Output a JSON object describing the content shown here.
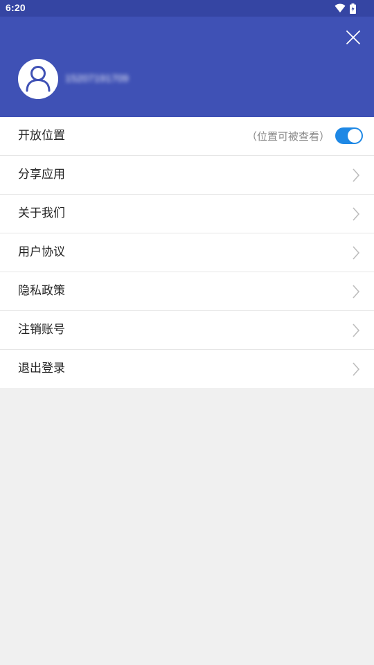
{
  "status_bar": {
    "time": "6:20",
    "icons": [
      "wifi-icon",
      "battery-icon"
    ]
  },
  "header": {
    "close_icon": "close-icon",
    "avatar_icon": "user-icon",
    "phone_number": "15207191709"
  },
  "menu": {
    "location": {
      "label": "开放位置",
      "hint": "（位置可被查看）",
      "toggle_on": true
    },
    "items": [
      {
        "label": "分享应用"
      },
      {
        "label": "关于我们"
      },
      {
        "label": "用户协议"
      },
      {
        "label": "隐私政策"
      },
      {
        "label": "注销账号"
      },
      {
        "label": "退出登录"
      }
    ]
  },
  "colors": {
    "header": "#3f51b5",
    "status_bar": "#3545a3",
    "toggle_on": "#1e88e5",
    "background": "#f0f0f0"
  }
}
